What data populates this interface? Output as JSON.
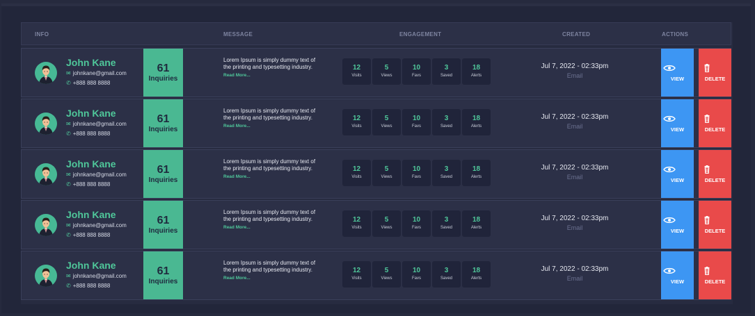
{
  "table": {
    "headers": {
      "info": "INFO",
      "message": "MESSAGE",
      "engagement": "ENGAGEMENT",
      "created": "CREATED",
      "actions": "ACTIONS"
    },
    "accent_color": "#4fc79a",
    "view_color": "#3d96f3",
    "delete_color": "#e94a4a",
    "rows": [
      {
        "name": "John Kane",
        "email": "johnkane@gmail.com",
        "phone": "+888 888 8888",
        "inquiries_count": "61",
        "inquiries_label": "Inquiries",
        "message": "Lorem Ipsum is simply dummy text of the printing and typesetting industry.",
        "read_more": "Read More...",
        "stats": [
          {
            "value": "12",
            "label": "Visits"
          },
          {
            "value": "5",
            "label": "Views"
          },
          {
            "value": "10",
            "label": "Favs"
          },
          {
            "value": "3",
            "label": "Saved"
          },
          {
            "value": "18",
            "label": "Alerts"
          }
        ],
        "created_date": "Jul  7, 2022 - 02:33pm",
        "created_via": "Email",
        "view_label": "VIEW",
        "delete_label": "DELETE"
      },
      {
        "name": "John Kane",
        "email": "johnkane@gmail.com",
        "phone": "+888 888 8888",
        "inquiries_count": "61",
        "inquiries_label": "Inquiries",
        "message": "Lorem Ipsum is simply dummy text of the printing and typesetting industry.",
        "read_more": "Read More...",
        "stats": [
          {
            "value": "12",
            "label": "Visits"
          },
          {
            "value": "5",
            "label": "Views"
          },
          {
            "value": "10",
            "label": "Favs"
          },
          {
            "value": "3",
            "label": "Saved"
          },
          {
            "value": "18",
            "label": "Alerts"
          }
        ],
        "created_date": "Jul  7, 2022 - 02:33pm",
        "created_via": "Email",
        "view_label": "VIEW",
        "delete_label": "DELETE"
      },
      {
        "name": "John Kane",
        "email": "johnkane@gmail.com",
        "phone": "+888 888 8888",
        "inquiries_count": "61",
        "inquiries_label": "Inquiries",
        "message": "Lorem Ipsum is simply dummy text of the printing and typesetting industry.",
        "read_more": "Read More...",
        "stats": [
          {
            "value": "12",
            "label": "Visits"
          },
          {
            "value": "5",
            "label": "Views"
          },
          {
            "value": "10",
            "label": "Favs"
          },
          {
            "value": "3",
            "label": "Saved"
          },
          {
            "value": "18",
            "label": "Alerts"
          }
        ],
        "created_date": "Jul  7, 2022 - 02:33pm",
        "created_via": "Email",
        "view_label": "VIEW",
        "delete_label": "DELETE"
      },
      {
        "name": "John Kane",
        "email": "johnkane@gmail.com",
        "phone": "+888 888 8888",
        "inquiries_count": "61",
        "inquiries_label": "Inquiries",
        "message": "Lorem Ipsum is simply dummy text of the printing and typesetting industry.",
        "read_more": "Read More...",
        "stats": [
          {
            "value": "12",
            "label": "Visits"
          },
          {
            "value": "5",
            "label": "Views"
          },
          {
            "value": "10",
            "label": "Favs"
          },
          {
            "value": "3",
            "label": "Saved"
          },
          {
            "value": "18",
            "label": "Alerts"
          }
        ],
        "created_date": "Jul  7, 2022 - 02:33pm",
        "created_via": "Email",
        "view_label": "VIEW",
        "delete_label": "DELETE"
      },
      {
        "name": "John Kane",
        "email": "johnkane@gmail.com",
        "phone": "+888 888 8888",
        "inquiries_count": "61",
        "inquiries_label": "Inquiries",
        "message": "Lorem Ipsum is simply dummy text of the printing and typesetting industry.",
        "read_more": "Read More...",
        "stats": [
          {
            "value": "12",
            "label": "Visits"
          },
          {
            "value": "5",
            "label": "Views"
          },
          {
            "value": "10",
            "label": "Favs"
          },
          {
            "value": "3",
            "label": "Saved"
          },
          {
            "value": "18",
            "label": "Alerts"
          }
        ],
        "created_date": "Jul  7, 2022 - 02:33pm",
        "created_via": "Email",
        "view_label": "VIEW",
        "delete_label": "DELETE"
      }
    ]
  }
}
